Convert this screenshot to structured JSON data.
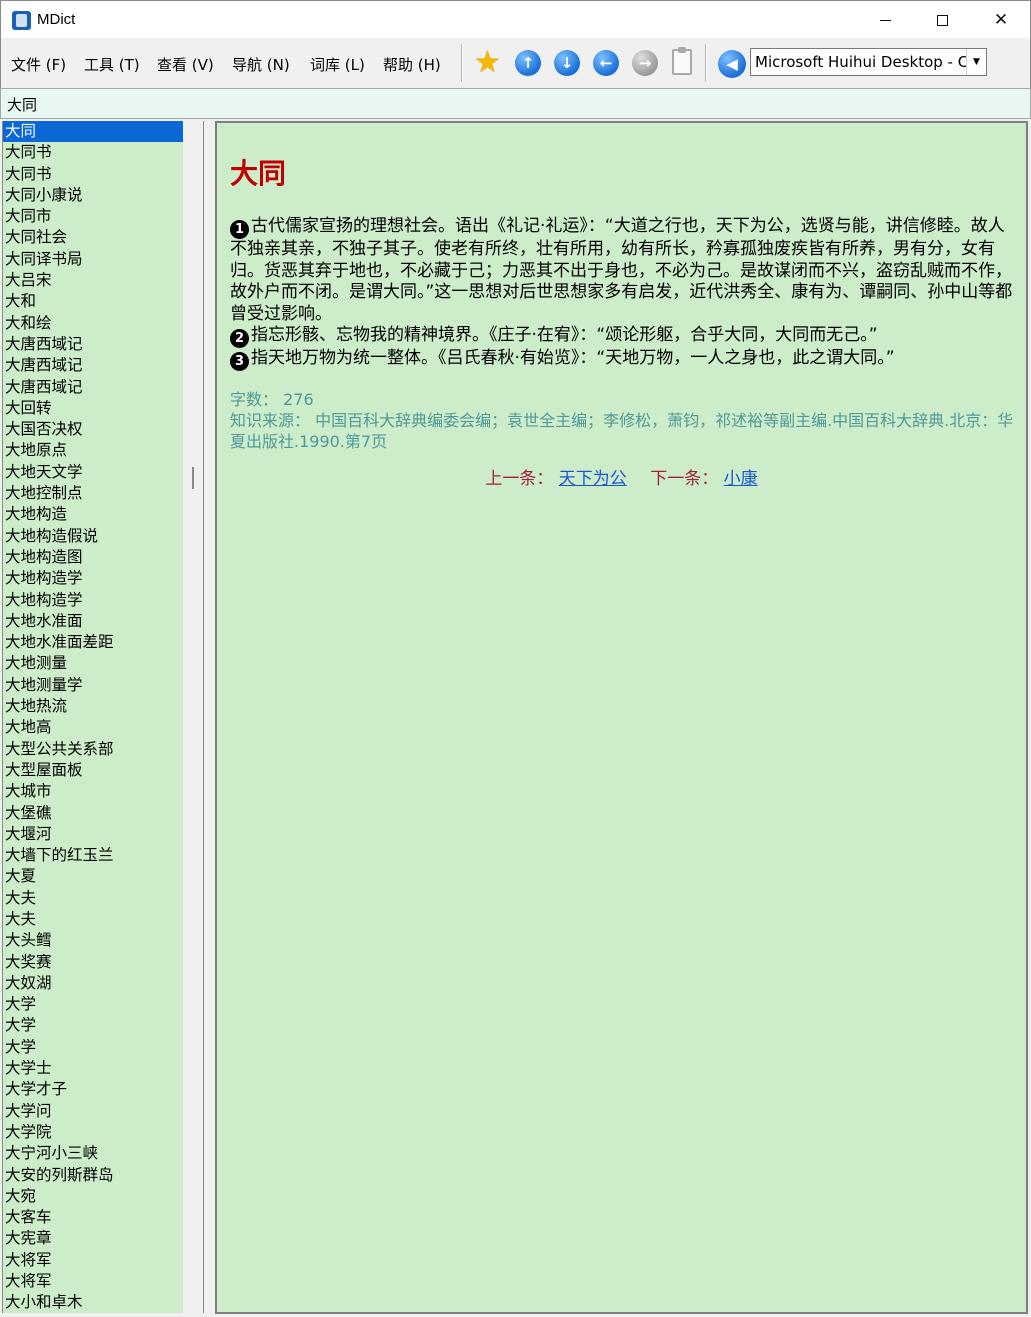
{
  "window": {
    "title": "MDict",
    "minimize": "—",
    "maximize": "☐",
    "close": "✕"
  },
  "menu": [
    {
      "label": "文件 (F)"
    },
    {
      "label": "工具 (T)"
    },
    {
      "label": "查看 (V)"
    },
    {
      "label": "导航 (N)"
    },
    {
      "label": "词库 (L)"
    },
    {
      "label": "帮助 (H)"
    }
  ],
  "toolbar": {
    "icons": [
      "favorite-star-icon",
      "up-arrow-icon",
      "down-arrow-icon",
      "back-arrow-icon",
      "forward-arrow-icon",
      "clipboard-icon",
      "speaker-icon"
    ],
    "dictionary_selected": "Microsoft Huihui Desktop - C"
  },
  "search": {
    "value": "大同"
  },
  "wordlist": [
    "大同",
    "大同书",
    "大同书",
    "大同小康说",
    "大同市",
    "大同社会",
    "大同译书局",
    "大吕宋",
    "大和",
    "大和绘",
    "大唐西域记",
    "大唐西域记",
    "大唐西域记",
    "大回转",
    "大国否决权",
    "大地原点",
    "大地天文学",
    "大地控制点",
    "大地构造",
    "大地构造假说",
    "大地构造图",
    "大地构造学",
    "大地构造学",
    "大地水准面",
    "大地水准面差距",
    "大地测量",
    "大地测量学",
    "大地热流",
    "大地高",
    "大型公共关系部",
    "大型屋面板",
    "大城市",
    "大堡礁",
    "大堰河",
    "大墙下的红玉兰",
    "大夏",
    "大夫",
    "大夫",
    "大头鳕",
    "大奖赛",
    "大奴湖",
    "大学",
    "大学",
    "大学",
    "大学士",
    "大学才子",
    "大学问",
    "大学院",
    "大宁河小三峡",
    "大安的列斯群岛",
    "大宛",
    "大客车",
    "大宪章",
    "大将军",
    "大将军",
    "大小和卓木"
  ],
  "entry": {
    "headword": "大同",
    "senses": [
      {
        "num": "1",
        "text": "古代儒家宣扬的理想社会。语出《礼记·礼运》：“大道之行也，天下为公，选贤与能，讲信修睦。故人不独亲其亲，不独子其子。使老有所终，壮有所用，幼有所长，矜寡孤独废疾皆有所养，男有分，女有归。货恶其弃于地也，不必藏于己；力恶其不出于身也，不必为己。是故谋闭而不兴，盗窃乱贼而不作，故外户而不闭。是谓大同。”这一思想对后世思想家多有启发，近代洪秀全、康有为、谭嗣同、孙中山等都曾受过影响。"
      },
      {
        "num": "2",
        "text": "指忘形骸、忘物我的精神境界。《庄子·在宥》：“颂论形躯，合乎大同，大同而无己。”"
      },
      {
        "num": "3",
        "text": "指天地万物为统一整体。《吕氏春秋·有始览》：“天地万物，一人之身也，此之谓大同。”"
      }
    ],
    "word_count": "字数： 276",
    "source": "知识来源： 中国百科大辞典编委会编；袁世全主编；李修松，萧钧，祁述裕等副主编.中国百科大辞典.北京：华夏出版社.1990.第7页",
    "prev_label": "上一条：",
    "prev_link": "天下为公",
    "next_label": "下一条：",
    "next_link": "小康"
  },
  "colors": {
    "content_bg": "#cdecca",
    "headword": "#c00000",
    "meta": "#4f9a9a",
    "nav_label": "#a02040",
    "link": "#1a56d8",
    "selection": "#0a67d4"
  }
}
